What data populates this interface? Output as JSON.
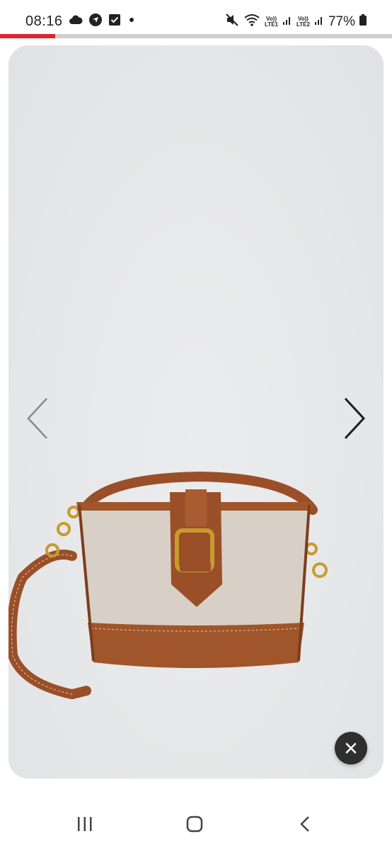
{
  "status_bar": {
    "time": "08:16",
    "battery": "77%",
    "sim1_label_top": "Vo))",
    "sim1_label_bottom": "LTE1",
    "sim2_label_top": "Vo))",
    "sim2_label_bottom": "LTE2",
    "icons": [
      "cloud-icon",
      "location-icon",
      "checkbox-icon",
      "dot-icon",
      "mute-icon",
      "wifi-icon",
      "signal-icon",
      "battery-icon"
    ]
  },
  "story_progress": {
    "fraction": 0.14,
    "fill_color": "#e0242b",
    "track_color": "#cfcfcf"
  },
  "viewer": {
    "image_alt_subject": "bucket-bag-image",
    "close_color": "#2f2f2f"
  },
  "nav_bar": {
    "buttons": [
      "recent-apps-icon",
      "home-icon",
      "back-icon"
    ]
  }
}
